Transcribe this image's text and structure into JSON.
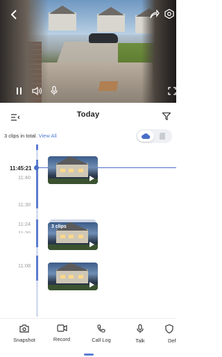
{
  "live_view": {
    "controls": [
      "back-icon",
      "share-icon",
      "settings-icon",
      "pause-icon",
      "speaker-icon",
      "microphone-icon",
      "fullscreen-icon"
    ]
  },
  "header": {
    "title": "Today"
  },
  "clips": {
    "summary": "3 clips in total.",
    "view_all": "View All"
  },
  "timeline": {
    "current_time": "11:45:21",
    "ticks": [
      "11:40",
      "11:30",
      "11:24",
      "11:20",
      "11:08"
    ],
    "group_badge": "3 clips"
  },
  "toolbar": {
    "items": [
      {
        "label": "Snapshot",
        "icon": "camera-icon"
      },
      {
        "label": "Record",
        "icon": "video-icon"
      },
      {
        "label": "Call Log",
        "icon": "phone-icon"
      },
      {
        "label": "Talk",
        "icon": "microphone-icon"
      },
      {
        "label": "Def",
        "icon": "shield-icon"
      }
    ]
  },
  "colors": {
    "accent": "#4a6fc7",
    "link": "#4a7bd6",
    "axis": "#d7def2"
  }
}
